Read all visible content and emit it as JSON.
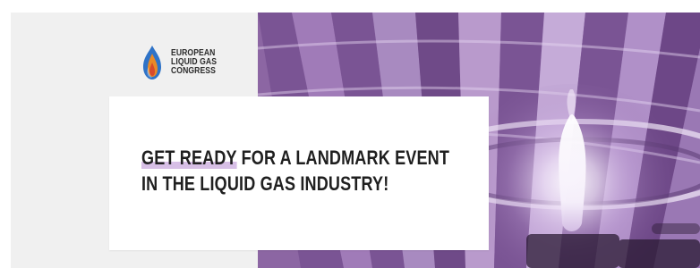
{
  "logo": {
    "name_lines": [
      "EUROPEAN",
      "LIQUID GAS",
      "CONGRESS"
    ],
    "icon": "flame-drop-icon",
    "colors": {
      "blue": "#2f73c7",
      "orange": "#e98a27",
      "red": "#d84a2b"
    }
  },
  "headline": {
    "highlight_text": "GET READY",
    "line1_rest": " FOR A LANDMARK EVENT",
    "line2": "IN THE LIQUID GAS INDUSTRY!"
  },
  "background_image": {
    "subject": "hot-air-balloon-burner-flame-photo",
    "tint": "#8c66a3"
  },
  "colors": {
    "left_panel": "#f0f0f0",
    "card": "#ffffff",
    "text": "#1f1f1f",
    "highlight": "#d7bfe6",
    "purple": "#8c66a3"
  }
}
